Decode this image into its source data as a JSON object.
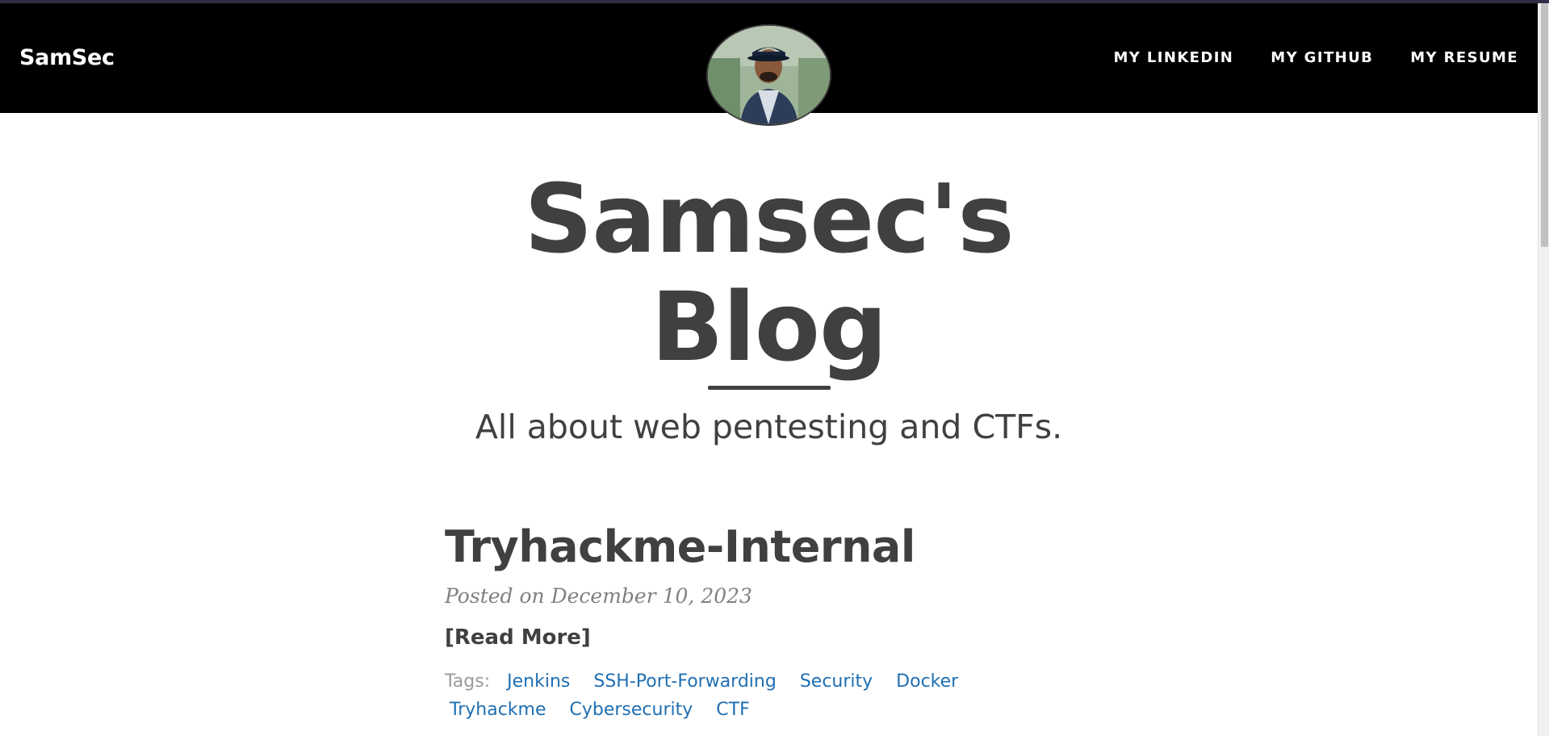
{
  "navbar": {
    "brand": "SamSec",
    "links": [
      {
        "label": "MY LINKEDIN"
      },
      {
        "label": "MY GITHUB"
      },
      {
        "label": "MY RESUME"
      }
    ]
  },
  "hero": {
    "title_line1": "Samsec's",
    "title_line2": "Blog",
    "subtitle": "All about web pentesting and CTFs."
  },
  "post": {
    "title": "Tryhackme-Internal",
    "meta": "Posted on December 10, 2023",
    "read_more": "[Read More]",
    "tags_label": "Tags:",
    "tags": [
      "Jenkins",
      "SSH-Port-Forwarding",
      "Security",
      "Docker",
      "Tryhackme",
      "Cybersecurity",
      "CTF"
    ]
  },
  "colors": {
    "navbar_bg": "#000000",
    "heading_text": "#404040",
    "tag_link": "#1f6fb2",
    "meta_text": "#808080"
  },
  "icons": {
    "avatar": "profile-photo"
  }
}
